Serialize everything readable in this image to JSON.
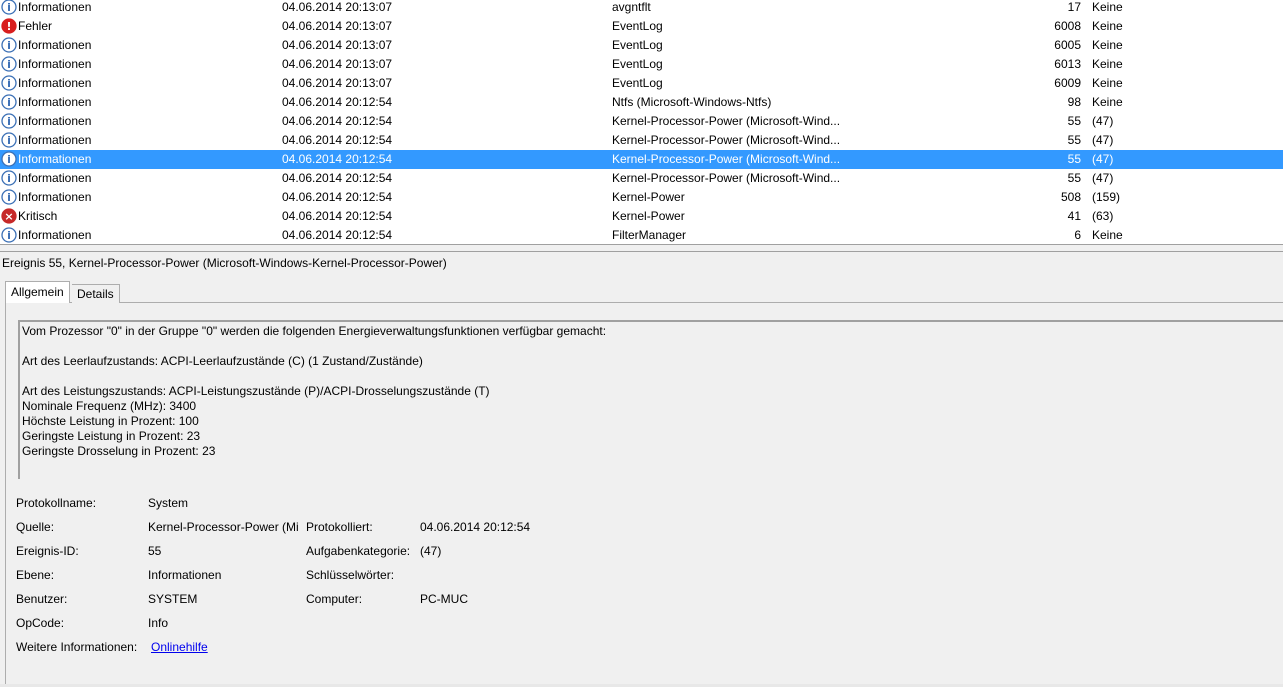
{
  "colors": {
    "info": "#3a6fb5",
    "error": "#d81e1e",
    "critical": "#c62828",
    "selection": "#3399ff"
  },
  "events": [
    {
      "level": "Informationen",
      "icon": "info-icon",
      "date": "04.06.2014 20:13:07",
      "source": "avgntflt",
      "id": "17",
      "category": "Keine"
    },
    {
      "level": "Fehler",
      "icon": "error-icon",
      "date": "04.06.2014 20:13:07",
      "source": "EventLog",
      "id": "6008",
      "category": "Keine"
    },
    {
      "level": "Informationen",
      "icon": "info-icon",
      "date": "04.06.2014 20:13:07",
      "source": "EventLog",
      "id": "6005",
      "category": "Keine"
    },
    {
      "level": "Informationen",
      "icon": "info-icon",
      "date": "04.06.2014 20:13:07",
      "source": "EventLog",
      "id": "6013",
      "category": "Keine"
    },
    {
      "level": "Informationen",
      "icon": "info-icon",
      "date": "04.06.2014 20:13:07",
      "source": "EventLog",
      "id": "6009",
      "category": "Keine"
    },
    {
      "level": "Informationen",
      "icon": "info-icon",
      "date": "04.06.2014 20:12:54",
      "source": "Ntfs (Microsoft-Windows-Ntfs)",
      "id": "98",
      "category": "Keine"
    },
    {
      "level": "Informationen",
      "icon": "info-icon",
      "date": "04.06.2014 20:12:54",
      "source": "Kernel-Processor-Power (Microsoft-Wind...",
      "id": "55",
      "category": "(47)"
    },
    {
      "level": "Informationen",
      "icon": "info-icon",
      "date": "04.06.2014 20:12:54",
      "source": "Kernel-Processor-Power (Microsoft-Wind...",
      "id": "55",
      "category": "(47)"
    },
    {
      "level": "Informationen",
      "icon": "info-icon",
      "date": "04.06.2014 20:12:54",
      "source": "Kernel-Processor-Power (Microsoft-Wind...",
      "id": "55",
      "category": "(47)",
      "selected": true
    },
    {
      "level": "Informationen",
      "icon": "info-icon",
      "date": "04.06.2014 20:12:54",
      "source": "Kernel-Processor-Power (Microsoft-Wind...",
      "id": "55",
      "category": "(47)"
    },
    {
      "level": "Informationen",
      "icon": "info-icon",
      "date": "04.06.2014 20:12:54",
      "source": "Kernel-Power",
      "id": "508",
      "category": "(159)"
    },
    {
      "level": "Kritisch",
      "icon": "critical-icon",
      "date": "04.06.2014 20:12:54",
      "source": "Kernel-Power",
      "id": "41",
      "category": "(63)"
    },
    {
      "level": "Informationen",
      "icon": "info-icon",
      "date": "04.06.2014 20:12:54",
      "source": "FilterManager",
      "id": "6",
      "category": "Keine"
    }
  ],
  "detail": {
    "title": "Ereignis 55, Kernel-Processor-Power (Microsoft-Windows-Kernel-Processor-Power)",
    "tabs": {
      "general": "Allgemein",
      "details": "Details"
    },
    "message": [
      "Vom Prozessor \"0\" in der Gruppe \"0\" werden die folgenden Energieverwaltungsfunktionen verfügbar gemacht:",
      "",
      "Art des Leerlaufzustands: ACPI-Leerlaufzustände (C) (1 Zustand/Zustände)",
      "",
      "Art des Leistungszustands: ACPI-Leistungszustände (P)/ACPI-Drosselungszustände (T)",
      "Nominale Frequenz (MHz): 3400",
      "Höchste Leistung in Prozent: 100",
      "Geringste Leistung in Prozent: 23",
      "Geringste Drosselung in Prozent: 23"
    ],
    "props": {
      "log_name_label": "Protokollname:",
      "log_name": "System",
      "source_label": "Quelle:",
      "source": "Kernel-Processor-Power (Mi",
      "logged_label": "Protokolliert:",
      "logged": "04.06.2014 20:12:54",
      "event_id_label": "Ereignis-ID:",
      "event_id": "55",
      "task_label": "Aufgabenkategorie:",
      "task": "(47)",
      "level_label": "Ebene:",
      "level": "Informationen",
      "keywords_label": "Schlüsselwörter:",
      "user_label": "Benutzer:",
      "user": "SYSTEM",
      "computer_label": "Computer:",
      "computer": "PC-MUC",
      "opcode_label": "OpCode:",
      "opcode": "Info",
      "more_label": "Weitere Informationen:",
      "more_link": "Onlinehilfe"
    }
  }
}
